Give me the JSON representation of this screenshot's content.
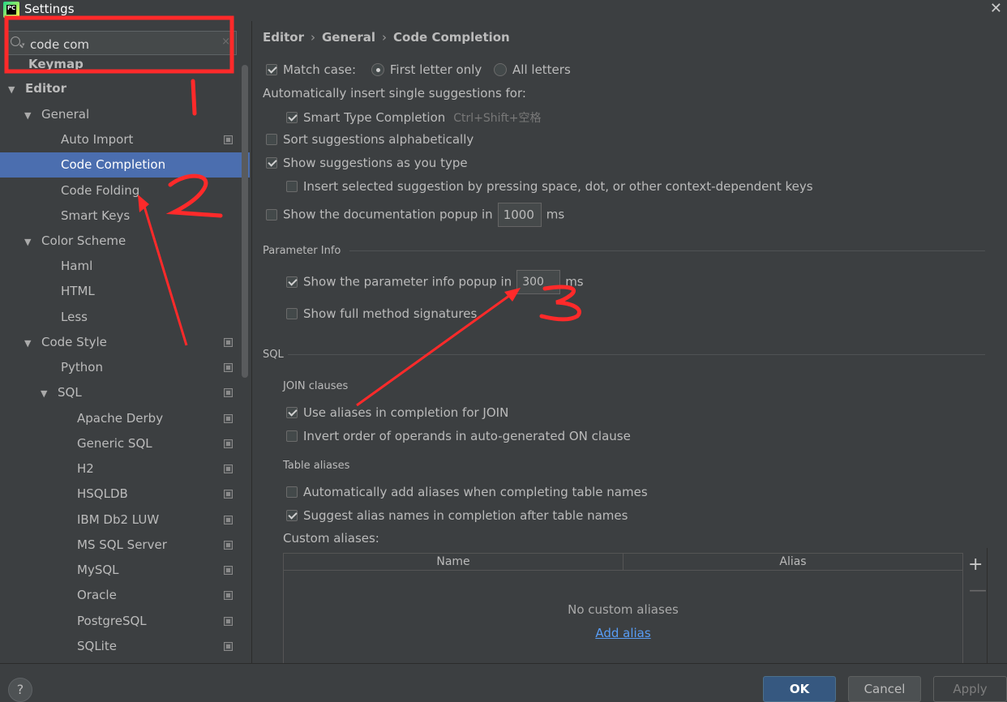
{
  "window": {
    "title": "Settings",
    "app_icon_text": "PC"
  },
  "search": {
    "value": "code com"
  },
  "tree": [
    {
      "label": "Keymap",
      "bold": true
    },
    {
      "label": "Editor",
      "arrow": "▼",
      "bold": true
    },
    {
      "label": "General",
      "arrow": "▼"
    },
    {
      "label": "Auto Import",
      "icon": true
    },
    {
      "label": "Code Completion",
      "selected": true
    },
    {
      "label": "Code Folding"
    },
    {
      "label": "Smart Keys"
    },
    {
      "label": "Color Scheme",
      "arrow": "▼"
    },
    {
      "label": "Haml"
    },
    {
      "label": "HTML"
    },
    {
      "label": "Less"
    },
    {
      "label": "Code Style",
      "arrow": "▼",
      "icon": true
    },
    {
      "label": "Python",
      "icon": true
    },
    {
      "label": "SQL",
      "arrow": "▼",
      "icon": true
    },
    {
      "label": "Apache Derby",
      "icon": true
    },
    {
      "label": "Generic SQL",
      "icon": true
    },
    {
      "label": "H2",
      "icon": true
    },
    {
      "label": "HSQLDB",
      "icon": true
    },
    {
      "label": "IBM Db2 LUW",
      "icon": true
    },
    {
      "label": "MS SQL Server",
      "icon": true
    },
    {
      "label": "MySQL",
      "icon": true
    },
    {
      "label": "Oracle",
      "icon": true
    },
    {
      "label": "PostgreSQL",
      "icon": true
    },
    {
      "label": "SQLite",
      "icon": true
    }
  ],
  "breadcrumb": [
    "Editor",
    "General",
    "Code Completion"
  ],
  "completion": {
    "match_case": "Match case:",
    "first_letter": "First letter only",
    "all_letters": "All letters",
    "auto_insert": "Automatically insert single suggestions for:",
    "smart_type": "Smart Type Completion",
    "smart_type_shortcut": "Ctrl+Shift+空格",
    "sort_alpha": "Sort suggestions alphabetically",
    "show_as_type": "Show suggestions as you type",
    "insert_selected": "Insert selected suggestion by pressing space, dot, or other context-dependent keys",
    "doc_popup": "Show the documentation popup in",
    "doc_popup_ms": "1000",
    "ms": "ms"
  },
  "param_info": {
    "title": "Parameter Info",
    "popup": "Show the parameter info popup in",
    "popup_ms": "300",
    "ms": "ms",
    "full_sig": "Show full method signatures"
  },
  "sql": {
    "title": "SQL",
    "join_title": "JOIN clauses",
    "use_aliases": "Use aliases in completion for JOIN",
    "invert_order": "Invert order of operands in auto-generated ON clause",
    "table_aliases_title": "Table aliases",
    "auto_add": "Automatically add aliases when completing table names",
    "suggest_alias": "Suggest alias names in completion after table names",
    "custom_aliases": "Custom aliases:",
    "col_name": "Name",
    "col_alias": "Alias",
    "empty": "No custom aliases",
    "add_alias": "Add alias",
    "plus": "+",
    "minus": "—"
  },
  "buttons": {
    "ok": "OK",
    "cancel": "Cancel",
    "apply": "Apply",
    "help": "?"
  },
  "annotations": {
    "n1": "1",
    "n2": "2",
    "n3": "3",
    "color": "#ff2a2a"
  }
}
